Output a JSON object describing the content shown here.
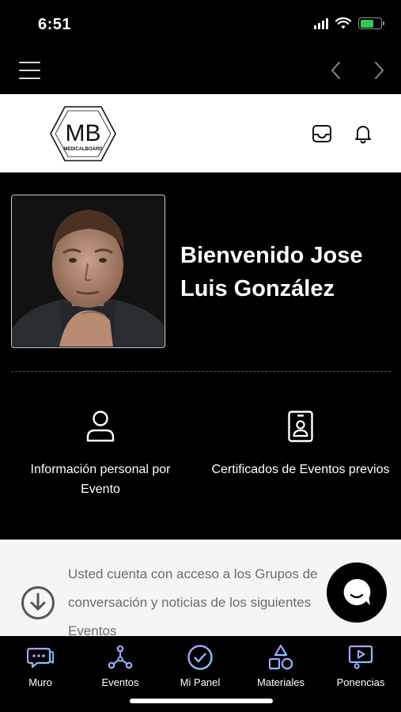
{
  "status_bar": {
    "time": "6:51",
    "battery_level": 0.65,
    "battery_color": "#36c759"
  },
  "top_nav": {
    "menu_icon": "hamburger-menu-icon",
    "back_icon": "chevron-left-icon",
    "forward_icon": "chevron-right-icon"
  },
  "header": {
    "logo_text": "MB",
    "logo_subtext": "MEDICALBOARD",
    "inbox_icon": "inbox-icon",
    "notifications_icon": "bell-icon"
  },
  "profile": {
    "welcome": "Bienvenido Jose Luis González"
  },
  "actions": [
    {
      "label": "Información personal por Evento",
      "icon": "user-icon"
    },
    {
      "label": "Certificados de Eventos previos",
      "icon": "id-badge-icon"
    }
  ],
  "info": {
    "text": "Usted cuenta con acceso a los Grupos de conversación y noticias de los siguientes Eventos",
    "icon": "download-circle-icon"
  },
  "chat": {
    "icon": "chat-bubble-icon"
  },
  "tabs": [
    {
      "label": "Muro",
      "icon": "chat-icon"
    },
    {
      "label": "Eventos",
      "icon": "network-icon"
    },
    {
      "label": "Mi Panel",
      "icon": "check-circle-icon"
    },
    {
      "label": "Materiales",
      "icon": "shapes-icon"
    },
    {
      "label": "Ponencias",
      "icon": "presentation-icon"
    }
  ],
  "colors": {
    "background": "#000000",
    "tab_icon_gradient_start": "#c58bff",
    "tab_icon_gradient_end": "#6ad6ff"
  }
}
